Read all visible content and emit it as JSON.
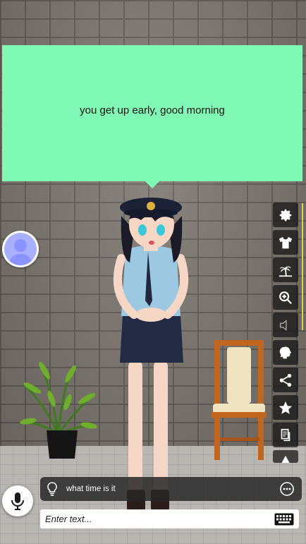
{
  "speech": {
    "text": "you get up early, good morning"
  },
  "toolbar": {
    "items": [
      {
        "name": "settings-button",
        "icon": "gear-icon"
      },
      {
        "name": "outfit-button",
        "icon": "shirt-icon"
      },
      {
        "name": "scene-button",
        "icon": "beach-icon"
      },
      {
        "name": "zoom-button",
        "icon": "zoom-in-icon"
      },
      {
        "name": "sound-button",
        "icon": "speaker-icon"
      },
      {
        "name": "brain-button",
        "icon": "brain-icon"
      },
      {
        "name": "share-button",
        "icon": "share-icon"
      },
      {
        "name": "favorite-button",
        "icon": "star-icon"
      },
      {
        "name": "message-button",
        "icon": "document-icon"
      },
      {
        "name": "warning-button",
        "icon": "warning-icon"
      }
    ]
  },
  "suggestion": {
    "text": "what time is it"
  },
  "chat_input": {
    "placeholder": "Enter text..."
  },
  "colors": {
    "bubble": "#80f9b4",
    "avatar": "#a9b0ff",
    "toolbar_bg": "#1a1a1a"
  }
}
